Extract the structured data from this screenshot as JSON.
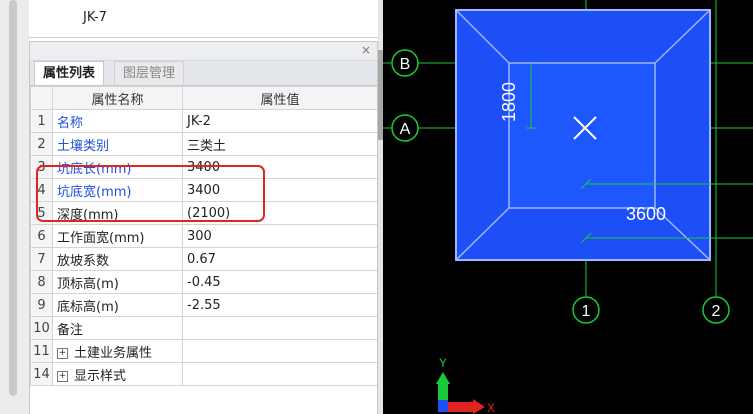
{
  "top_panel": {
    "item": "JK-7"
  },
  "property_panel": {
    "close_glyph": "×",
    "tabs": [
      {
        "label": "属性列表",
        "active": true
      },
      {
        "label": "图层管理",
        "active": false
      }
    ],
    "columns": {
      "name": "属性名称",
      "value": "属性值"
    },
    "rows": [
      {
        "num": "1",
        "name": "名称",
        "value": "JK-2"
      },
      {
        "num": "2",
        "name": "土壤类别",
        "value": "三类土"
      },
      {
        "num": "3",
        "name": "坑底长(mm)",
        "value": "3400"
      },
      {
        "num": "4",
        "name": "坑底宽(mm)",
        "value": "3400"
      },
      {
        "num": "5",
        "name": "深度(mm)",
        "value": "(2100)"
      },
      {
        "num": "6",
        "name": "工作面宽(mm)",
        "value": "300"
      },
      {
        "num": "7",
        "name": "放坡系数",
        "value": "0.67"
      },
      {
        "num": "8",
        "name": "顶标高(m)",
        "value": "-0.45"
      },
      {
        "num": "9",
        "name": "底标高(m)",
        "value": "-2.55"
      },
      {
        "num": "10",
        "name": "备注",
        "value": ""
      },
      {
        "num": "11",
        "name": "土建业务属性",
        "value": "",
        "expander": "+"
      },
      {
        "num": "14",
        "name": "显示样式",
        "value": "",
        "expander": "+"
      }
    ]
  },
  "canvas": {
    "axis_labels": {
      "b": "B",
      "a": "A",
      "one": "1",
      "two": "2"
    },
    "dimensions": {
      "vertical": "1800",
      "horizontal": "3600"
    },
    "ucs": {
      "y": "Y",
      "x": "X"
    },
    "colors": {
      "pit": "#1c4ff5",
      "inner": "#1f57ff",
      "grid": "#19c93a",
      "background": "#000000",
      "highlight": "#e0241f"
    }
  }
}
